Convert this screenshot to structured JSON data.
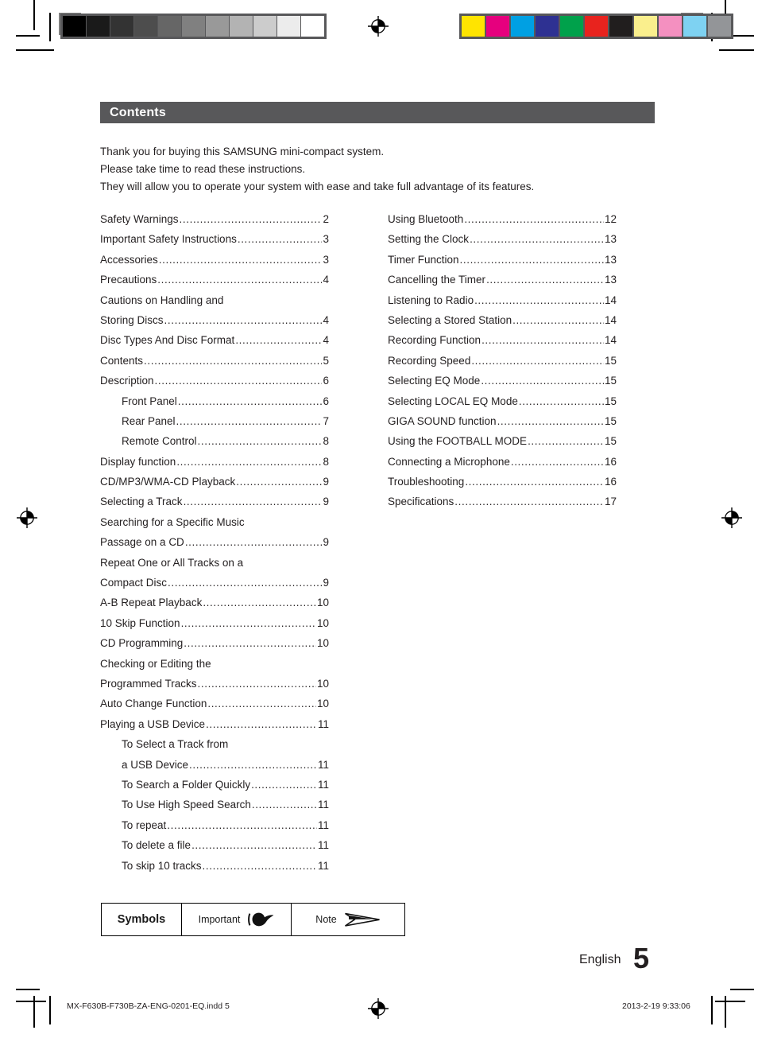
{
  "header": {
    "title": "Contents",
    "bar_color": "#58585a"
  },
  "intro": {
    "line1": "Thank you for buying this SAMSUNG mini-compact system.",
    "line2": "Please take time to read these instructions.",
    "line3": "They will allow you to operate your system with ease and take full advantage of its features."
  },
  "toc": {
    "left": [
      {
        "label": "Safety Warnings",
        "page": "2",
        "indent": false,
        "dots": true
      },
      {
        "label": "Important Safety Instructions",
        "page": "3",
        "indent": false,
        "dots": true
      },
      {
        "label": "Accessories",
        "page": "3",
        "indent": false,
        "dots": true
      },
      {
        "label": "Precautions",
        "page": "4",
        "indent": false,
        "dots": true
      },
      {
        "label": "Cautions on Handling and",
        "page": "",
        "indent": false,
        "dots": false
      },
      {
        "label": "Storing Discs",
        "page": "4",
        "indent": false,
        "dots": true
      },
      {
        "label": "Disc Types And Disc Format",
        "page": "4",
        "indent": false,
        "dots": true
      },
      {
        "label": "Contents",
        "page": "5",
        "indent": false,
        "dots": true
      },
      {
        "label": "Description",
        "page": "6",
        "indent": false,
        "dots": true
      },
      {
        "label": "Front Panel",
        "page": "6",
        "indent": true,
        "dots": true
      },
      {
        "label": "Rear Panel",
        "page": "7",
        "indent": true,
        "dots": true
      },
      {
        "label": "Remote Control",
        "page": "8",
        "indent": true,
        "dots": true
      },
      {
        "label": "Display function",
        "page": "8",
        "indent": false,
        "dots": true
      },
      {
        "label": "CD/MP3/WMA-CD Playback",
        "page": "9",
        "indent": false,
        "dots": true
      },
      {
        "label": "Selecting a Track",
        "page": "9",
        "indent": false,
        "dots": true
      },
      {
        "label": "Searching for a Specific Music",
        "page": "",
        "indent": false,
        "dots": false
      },
      {
        "label": "Passage on a CD",
        "page": "9",
        "indent": false,
        "dots": true
      },
      {
        "label": "Repeat One or All Tracks on a",
        "page": "",
        "indent": false,
        "dots": false
      },
      {
        "label": "Compact Disc",
        "page": "9",
        "indent": false,
        "dots": true
      },
      {
        "label": "A-B Repeat Playback",
        "page": "10",
        "indent": false,
        "dots": true
      },
      {
        "label": "10 Skip Function",
        "page": "10",
        "indent": false,
        "dots": true
      },
      {
        "label": "CD Programming",
        "page": "10",
        "indent": false,
        "dots": true
      },
      {
        "label": "Checking or Editing the",
        "page": "",
        "indent": false,
        "dots": false
      },
      {
        "label": "Programmed Tracks",
        "page": "10",
        "indent": false,
        "dots": true
      },
      {
        "label": "Auto Change Function",
        "page": "10",
        "indent": false,
        "dots": true
      },
      {
        "label": "Playing a USB Device",
        "page": "11",
        "indent": false,
        "dots": true
      },
      {
        "label": "To Select a Track from",
        "page": "",
        "indent": true,
        "dots": false
      },
      {
        "label": "a USB Device",
        "page": "11",
        "indent": true,
        "dots": true
      },
      {
        "label": "To Search a Folder Quickly",
        "page": "11",
        "indent": true,
        "dots": true
      },
      {
        "label": "To Use High Speed Search",
        "page": "11",
        "indent": true,
        "dots": true
      },
      {
        "label": "To repeat",
        "page": "11",
        "indent": true,
        "dots": true
      },
      {
        "label": "To delete a file",
        "page": "11",
        "indent": true,
        "dots": true
      },
      {
        "label": "To skip 10 tracks",
        "page": "11",
        "indent": true,
        "dots": true
      }
    ],
    "right": [
      {
        "label": "Using Bluetooth",
        "page": "12",
        "indent": false,
        "dots": true
      },
      {
        "label": "Setting the Clock",
        "page": "13",
        "indent": false,
        "dots": true
      },
      {
        "label": "Timer Function",
        "page": "13",
        "indent": false,
        "dots": true
      },
      {
        "label": "Cancelling the Timer",
        "page": "13",
        "indent": false,
        "dots": true
      },
      {
        "label": "Listening to Radio",
        "page": "14",
        "indent": false,
        "dots": true
      },
      {
        "label": "Selecting a Stored Station",
        "page": "14",
        "indent": false,
        "dots": true
      },
      {
        "label": "Recording Function",
        "page": "14",
        "indent": false,
        "dots": true
      },
      {
        "label": "Recording Speed",
        "page": "15",
        "indent": false,
        "dots": true
      },
      {
        "label": "Selecting  EQ Mode",
        "page": "15",
        "indent": false,
        "dots": true
      },
      {
        "label": "Selecting  LOCAL EQ Mode",
        "page": "15",
        "indent": false,
        "dots": true
      },
      {
        "label": "GIGA SOUND function",
        "page": "15",
        "indent": false,
        "dots": true
      },
      {
        "label": "Using the FOOTBALL MODE",
        "page": "15",
        "indent": false,
        "dots": true
      },
      {
        "label": "Connecting a Microphone",
        "page": "16",
        "indent": false,
        "dots": true
      },
      {
        "label": "Troubleshooting",
        "page": "16",
        "indent": false,
        "dots": true
      },
      {
        "label": "Specifications",
        "page": "17",
        "indent": false,
        "dots": true
      }
    ]
  },
  "symbols": {
    "title": "Symbols",
    "important_label": "Important",
    "important_icon": "pointing-hand-icon",
    "note_label": "Note",
    "note_icon": "arrow-chevron-icon"
  },
  "footer": {
    "language": "English",
    "page_number": "5",
    "file_name": "MX-F630B-F730B-ZA-ENG-0201-EQ.indd   5",
    "timestamp": "2013-2-19   9:33:06"
  },
  "print_marks": {
    "gray_wedge": [
      "#000000",
      "#1a1a1a",
      "#333333",
      "#4d4d4d",
      "#666666",
      "#808080",
      "#999999",
      "#b3b3b3",
      "#cccccc",
      "#ececec",
      "#ffffff"
    ],
    "color_wedge": [
      "#ffe400",
      "#e6007e",
      "#00a0e3",
      "#2e3192",
      "#00a14b",
      "#e8231e",
      "#211e1e",
      "#faef8d",
      "#f490c0",
      "#7ed2f2",
      "#939598"
    ],
    "registration_icon": "registration-target-icon"
  }
}
